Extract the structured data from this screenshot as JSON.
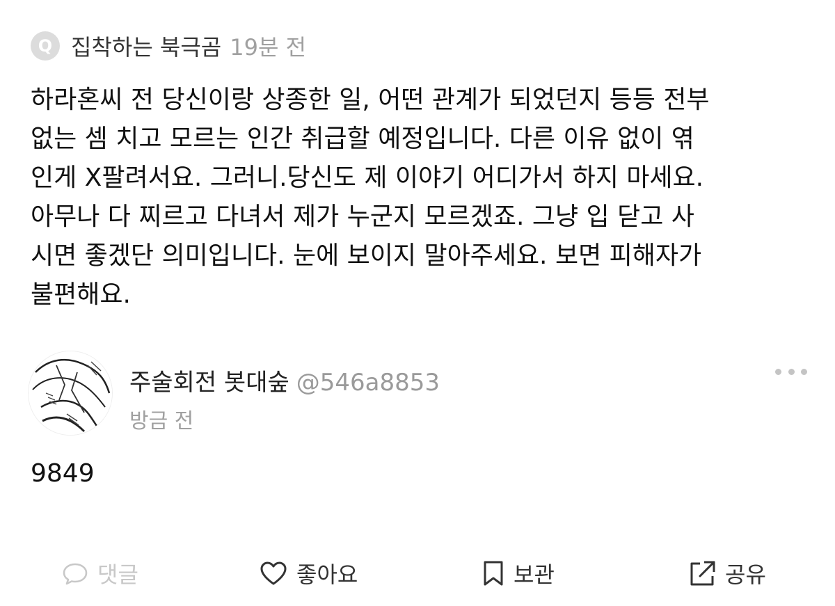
{
  "question": {
    "icon_letter": "Q",
    "asker_name": "집착하는 북극곰",
    "time": "19분 전",
    "body": "하라혼씨 전 당신이랑 상종한 일, 어떤 관계가 되었던지 등등 전부\n없는 셈 치고 모르는 인간 취급할 예정입니다. 다른 이유 없이 엮\n인게 X팔려서요. 그러니.당신도 제 이야기 어디가서 하지 마세요.\n아무나 다 찌르고 다녀서 제가 누군지 모르겠죠. 그냥 입 닫고 사\n시면 좋겠단 의미입니다. 눈에 보이지 말아주세요. 보면 피해자가\n불편해요."
  },
  "answer": {
    "avatar_icon": "avatar-illustration-icon",
    "name": "주술회전 봇대숲",
    "handle": "@546a8853",
    "time": "방금 전",
    "more_icon": "more-dots-icon",
    "body": "9849"
  },
  "actions": {
    "comment_label": "댓글",
    "like_label": "좋아요",
    "save_label": "보관",
    "share_label": "공유"
  },
  "colors": {
    "muted_text": "#a0a0a0",
    "disabled_action": "#c8c8c8",
    "icon_bg": "#dcdcdc"
  }
}
